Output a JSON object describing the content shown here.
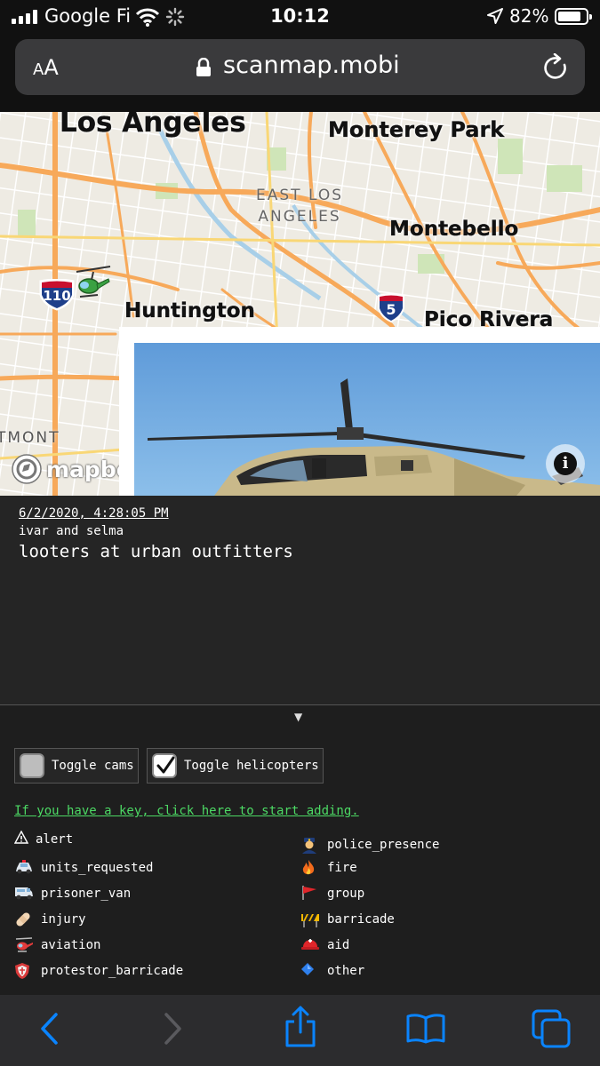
{
  "status": {
    "carrier": "Google Fi",
    "time": "10:12",
    "battery_pct": "82%",
    "battery_level": 0.82
  },
  "browser": {
    "text_size_label": "AA",
    "domain": "scanmap.mobi"
  },
  "map": {
    "labels": {
      "los_angeles": "Los Angeles",
      "monterey_park": "Monterey Park",
      "east_los_angeles_1": "EAST LOS",
      "east_los_angeles_2": "ANGELES",
      "montebello": "Montebello",
      "huntington": "Huntington",
      "pico_rivera": "Pico Rivera",
      "mont": "TMONT"
    },
    "shields": {
      "i110": "110",
      "i5": "5"
    },
    "attribution": "mapbox"
  },
  "report": {
    "timestamp": "6/2/2020, 4:28:05 PM",
    "location": "ivar and selma",
    "message": "looters at urban outfitters"
  },
  "controls": {
    "toggle_cams": {
      "label": "Toggle cams",
      "checked": false
    },
    "toggle_helicopters": {
      "label": "Toggle helicopters",
      "checked": true
    },
    "key_link": "If you have a key, click here to start adding."
  },
  "legend": [
    {
      "label": "alert",
      "icon": "warning-icon"
    },
    {
      "label": "police_presence",
      "icon": "police-officer-icon"
    },
    {
      "label": "units_requested",
      "icon": "police-car-icon"
    },
    {
      "label": "fire",
      "icon": "fire-icon"
    },
    {
      "label": "prisoner_van",
      "icon": "van-icon"
    },
    {
      "label": "group",
      "icon": "red-flag-icon"
    },
    {
      "label": "injury",
      "icon": "bandage-icon"
    },
    {
      "label": "barricade",
      "icon": "construction-barrier-icon"
    },
    {
      "label": "aviation",
      "icon": "helicopter-icon"
    },
    {
      "label": "aid",
      "icon": "rescue-helmet-icon"
    },
    {
      "label": "protestor_barricade",
      "icon": "shield-icon"
    },
    {
      "label": "other",
      "icon": "blue-diamond-icon"
    }
  ]
}
